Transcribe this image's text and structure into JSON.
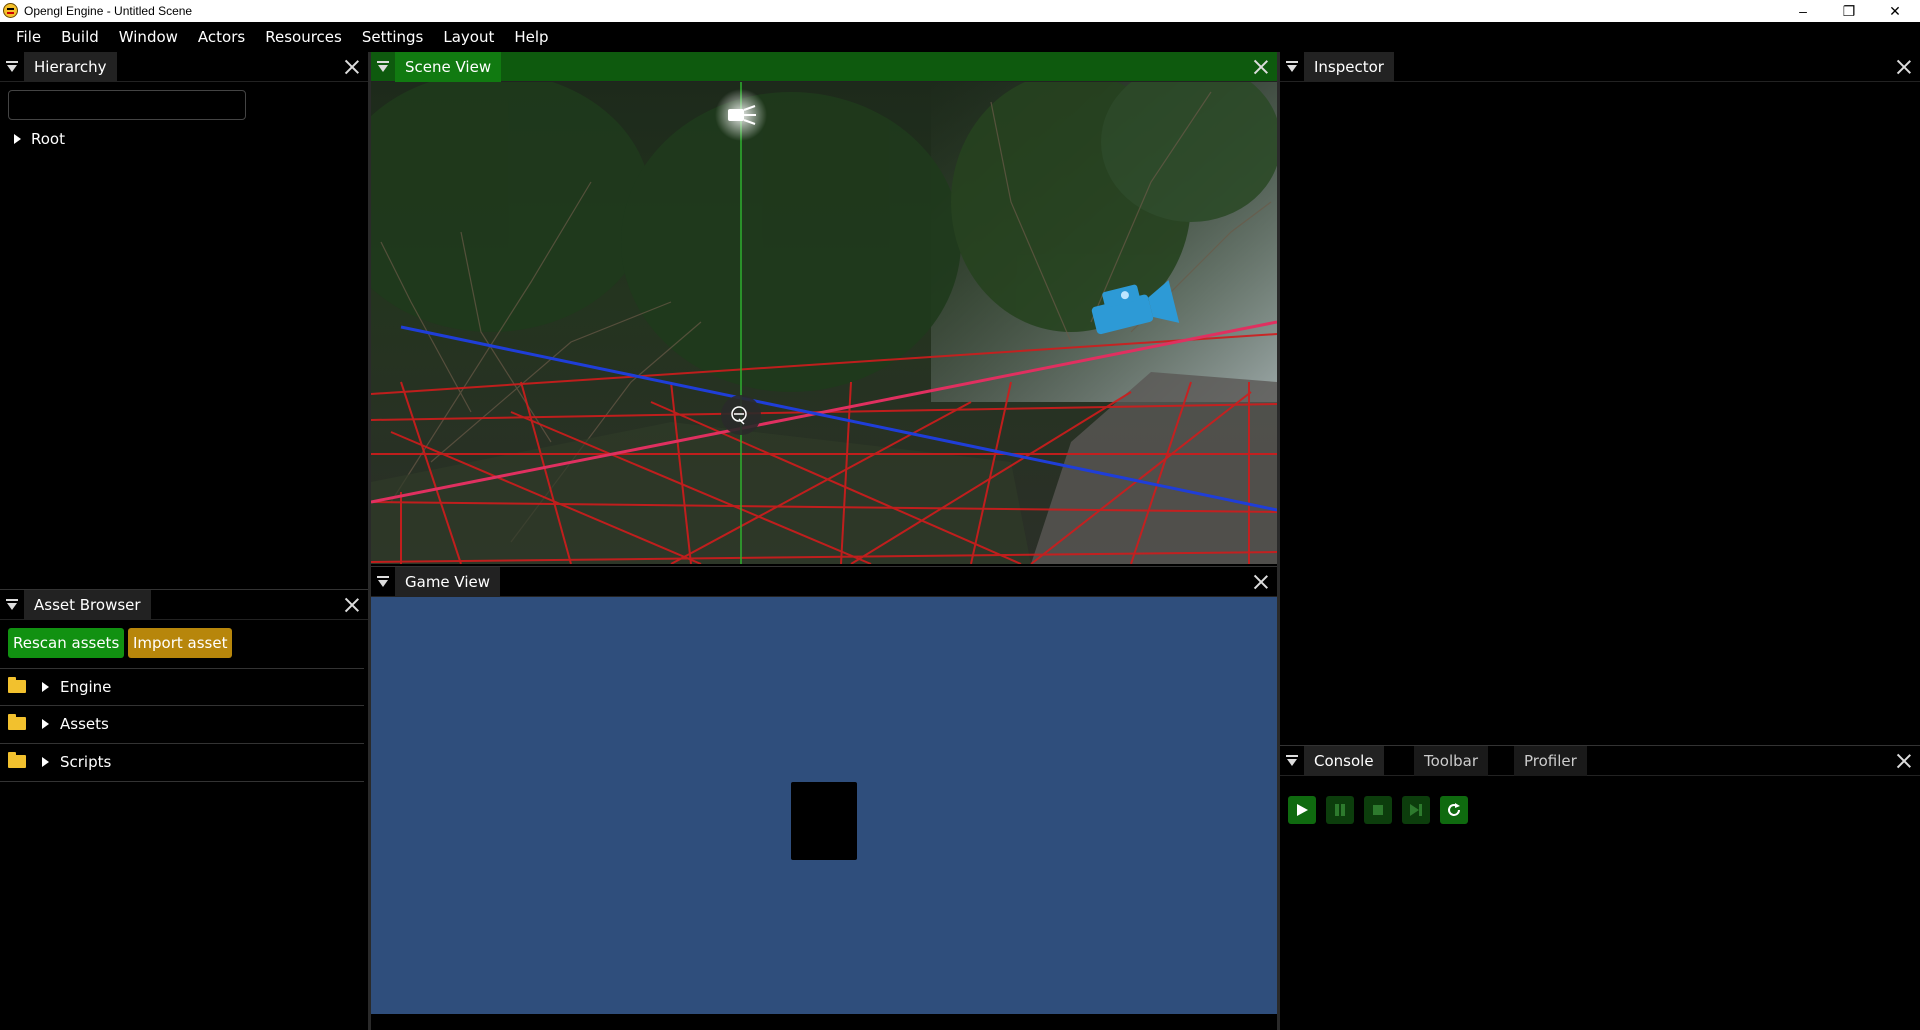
{
  "window": {
    "title": "Opengl Engine - Untitled Scene",
    "minimize_glyph": "–",
    "restore_glyph": "❐",
    "close_glyph": "✕"
  },
  "menubar": {
    "items": [
      "File",
      "Build",
      "Window",
      "Actors",
      "Resources",
      "Settings",
      "Layout",
      "Help"
    ]
  },
  "hierarchy": {
    "tab": "Hierarchy",
    "search_value": "",
    "root_label": "Root"
  },
  "asset_browser": {
    "tab": "Asset Browser",
    "rescan_label": "Rescan assets",
    "import_label": "Import asset",
    "folders": [
      "Engine",
      "Assets",
      "Scripts"
    ]
  },
  "scene_view": {
    "tab": "Scene View"
  },
  "game_view": {
    "tab": "Game View"
  },
  "inspector": {
    "tab": "Inspector"
  },
  "bottom_right": {
    "tabs": [
      "Console",
      "Toolbar",
      "Profiler"
    ],
    "controls": [
      "play-icon",
      "pause-icon",
      "stop-icon",
      "step-icon",
      "refresh-icon"
    ]
  },
  "colors": {
    "active_tab_bg": "#117a11",
    "active_header_bg": "#0e5a0e",
    "rescan_button": "#119111",
    "import_button": "#b7860b",
    "game_view_bg": "#2f4e7c",
    "grid_red": "#d01c1c",
    "axis_blue": "#1f3ed8",
    "axis_green": "#2fb02f",
    "folder_yellow": "#f2c12e"
  }
}
